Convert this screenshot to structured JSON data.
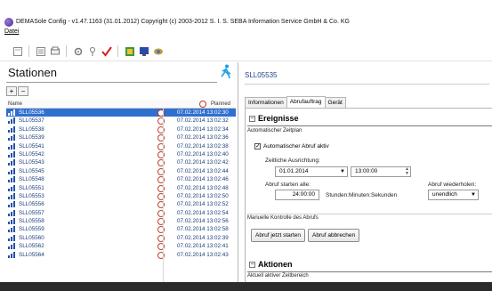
{
  "window": {
    "title": "DEMASole Config - v1.47.1163 (31.01.2012) Copyright (c) 2003-2012 S. I. S. SEBA Information Service GmbH & Co. KG"
  },
  "menu": {
    "datei": "Datei"
  },
  "icons": {
    "toolbar": [
      "sheet-icon",
      "sheet-lines-icon",
      "print-preview-icon",
      "gear-icon",
      "lock-icon",
      "check-icon",
      "page-add-icon",
      "monitor-icon",
      "eye-icon"
    ],
    "left": [
      "run-icon",
      "add-icon",
      "remove-icon"
    ]
  },
  "colors": {
    "selection": "#2f6fd0",
    "link_blue": "#1a3d7a",
    "clock_red": "#c0402a",
    "runner_blue": "#1aa0e0"
  },
  "left": {
    "title": "Stationen",
    "add_label": "+",
    "remove_label": "−",
    "columns": {
      "name": "Name",
      "planned": "Planned"
    },
    "rows": [
      {
        "name": "SLL05536",
        "date": "07.02.2014 13:02:30",
        "selected": true
      },
      {
        "name": "SLL05537",
        "date": "07.02.2014 13:02:32"
      },
      {
        "name": "SLL05538",
        "date": "07.02.2014 13:02:34"
      },
      {
        "name": "SLL05539",
        "date": "07.02.2014 13:02:36"
      },
      {
        "name": "SLL05541",
        "date": "07.02.2014 13:02:38"
      },
      {
        "name": "SLL05542",
        "date": "07.02.2014 13:02:40"
      },
      {
        "name": "SLL05543",
        "date": "07.02.2014 13:02:42"
      },
      {
        "name": "SLL05545",
        "date": "07.02.2014 13:02:44"
      },
      {
        "name": "SLL05548",
        "date": "07.02.2014 13:02:46"
      },
      {
        "name": "SLL05551",
        "date": "07.02.2014 13:02:48"
      },
      {
        "name": "SLL05553",
        "date": "07.02.2014 13:02:50"
      },
      {
        "name": "SLL05556",
        "date": "07.02.2014 13:02:52"
      },
      {
        "name": "SLL05557",
        "date": "07.02.2014 13:02:54"
      },
      {
        "name": "SLL05558",
        "date": "07.02.2014 13:02:56"
      },
      {
        "name": "SLL05559",
        "date": "07.02.2014 13:02:58"
      },
      {
        "name": "SLL05560",
        "date": "07.02.2014 13:02:39"
      },
      {
        "name": "SLL05562",
        "date": "07.02.2014 13:02:41"
      },
      {
        "name": "SLL05564",
        "date": "07.02.2014 13:02:43"
      }
    ]
  },
  "right": {
    "station_id": "SLL05535",
    "tabs": [
      "Informationen",
      "Abrufauftrag",
      "Gerät"
    ],
    "active_tab": 1,
    "section1": "Ereignisse",
    "group_auto": "Automatischer Zeitplan",
    "auto_checkbox": "Automatischer Abruf aktiv",
    "auto_checked": "✓",
    "time_label": "Zeitliche Ausrichtung:",
    "date_value": "01.01.2014",
    "time_value": "13:00:00",
    "interval_label": "Abruf starten alle:",
    "interval_value": "24:00:00",
    "interval_unit": "Stunden:Minuten:Sekunden",
    "repeat_label": "Abruf wiederholen:",
    "repeat_value": "unendlich",
    "group_manual": "Manuelle Kontrolle des Abrufs",
    "btn_start": "Abruf jetzt starten",
    "btn_cancel": "Abruf abbrechen",
    "section2": "Aktionen",
    "group_actions": "Aktuell aktiver Zeitbereich"
  }
}
